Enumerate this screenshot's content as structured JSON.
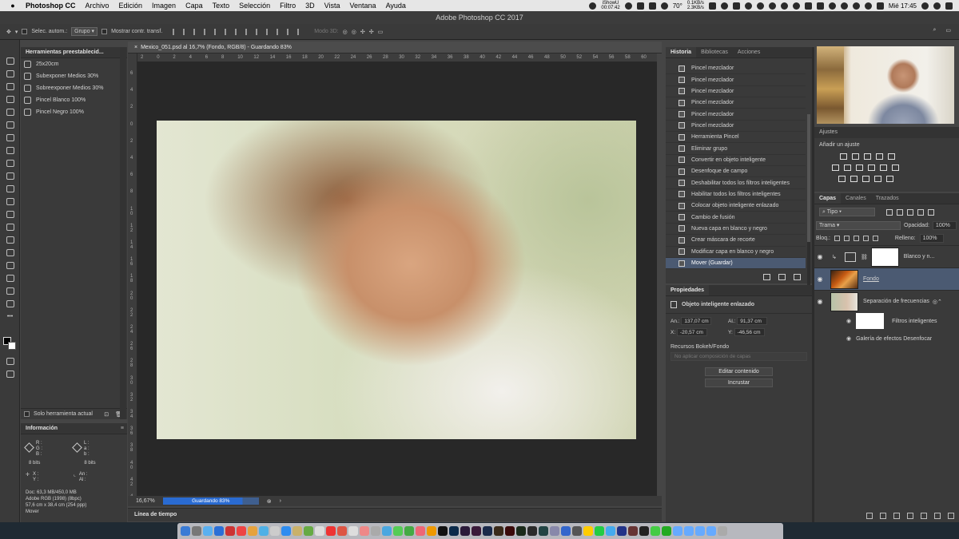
{
  "menubar": {
    "app": "Photoshop CC",
    "menus": [
      "Archivo",
      "Edición",
      "Imagen",
      "Capa",
      "Texto",
      "Selección",
      "Filtro",
      "3D",
      "Vista",
      "Ventana",
      "Ayuda"
    ],
    "ishowu": "iShowU",
    "ishowu_time": "00:07:42",
    "temperature": "70°",
    "net_up": "0.1KB/s",
    "net_down": "2.3KB/s",
    "clock": "Mié 17:45"
  },
  "window": {
    "title": "Adobe Photoshop CC 2017"
  },
  "options": {
    "auto_select_label": "Selec. autom.:",
    "auto_select_value": "Grupo",
    "show_transform_label": "Mostrar contr. transf.",
    "mode3d_label": "Modo 3D:"
  },
  "presets_panel": {
    "title": "Herramientas preestablecid...",
    "items": [
      {
        "label": "25x20cm",
        "icon": "crop-icon"
      },
      {
        "label": "Subexponer Medios 30%",
        "icon": "dodge-icon"
      },
      {
        "label": "Sobreexponer Medios 30%",
        "icon": "burn-icon"
      },
      {
        "label": "Pincel Blanco 100%",
        "icon": "brush-icon"
      },
      {
        "label": "Pincel Negro 100%",
        "icon": "brush-icon"
      }
    ],
    "current_tool_only": "Solo herramienta actual"
  },
  "info_panel": {
    "title": "Información",
    "rgb": [
      "R :",
      "G :",
      "B :"
    ],
    "lab": [
      "L :",
      "a :",
      "b :"
    ],
    "bits_left": "8 bits",
    "bits_right": "8 bits",
    "xy": [
      "X :",
      "Y :"
    ],
    "size": [
      "An :",
      "Al :"
    ],
    "doc": "Doc: 63,3 MB/450,0 MB",
    "profile": "Adobe RGB (1998) (8bpc)",
    "dimensions": "57,6 cm x 38,4 cm (254 ppp)",
    "tool": "Mover"
  },
  "document": {
    "tab": "Mexico_051.psd al 16,7% (Fondo, RGB/8) - Guardando 83%",
    "zoom": "16,67%",
    "status": "Guardando 83%",
    "progress": 0.83,
    "hruler": [
      "2",
      "0",
      "2",
      "4",
      "6",
      "8",
      "10",
      "12",
      "14",
      "16",
      "18",
      "20",
      "22",
      "24",
      "26",
      "28",
      "30",
      "32",
      "34",
      "36",
      "38",
      "40",
      "42",
      "44",
      "46",
      "48",
      "50",
      "52",
      "54",
      "56",
      "58",
      "60"
    ],
    "vruler": [
      "6",
      "4",
      "2",
      "0",
      "2",
      "4",
      "6",
      "8",
      "1 0",
      "1 2",
      "1 4",
      "1 6",
      "1 8",
      "2 0",
      "2 2",
      "2 4",
      "2 6",
      "2 8",
      "3 0",
      "3 2",
      "3 4",
      "3 6",
      "3 8",
      "4 0",
      "4 2",
      "4 4"
    ],
    "timeline": "Línea de tiempo"
  },
  "history_panel": {
    "tabs": [
      "Historia",
      "Bibliotecas",
      "Acciones"
    ],
    "items": [
      "Pincel mezclador",
      "Pincel mezclador",
      "Pincel mezclador",
      "Pincel mezclador",
      "Pincel mezclador",
      "Pincel mezclador",
      "Herramienta Pincel",
      "Eliminar grupo",
      "Convertir en objeto inteligente",
      "Desenfoque de campo",
      "Deshabilitar todos los filtros inteligentes",
      "Habilitar todos los filtros inteligentes",
      "Colocar objeto inteligente enlazado",
      "Cambio de fusión",
      "Nueva capa en blanco y negro",
      "Crear máscara de recorte",
      "Modificar capa en blanco y negro",
      "Mover (Guardar)"
    ],
    "selected_index": 17
  },
  "properties_panel": {
    "title": "Propiedades",
    "subtitle": "Objeto inteligente enlazado",
    "an_label": "An.:",
    "an_value": "137,07 cm",
    "al_label": "Al.:",
    "al_value": "91,37 cm",
    "x_label": "X:",
    "x_value": "-20,57 cm",
    "y_label": "Y:",
    "y_value": "-46,56 cm",
    "resources_label": "Recursos Bokeh/Fondo",
    "comp_placeholder": "No aplicar composición de capas",
    "edit_button": "Editar contenido",
    "embed_button": "Incrustar"
  },
  "adjustments_panel": {
    "title": "Ajustes",
    "add_label": "Añadir un ajuste"
  },
  "layers_panel": {
    "tabs": [
      "Capas",
      "Canales",
      "Trazados"
    ],
    "filter": "Tipo",
    "blend_mode": "Trama",
    "opacity_label": "Opacidad:",
    "opacity_value": "100%",
    "lock_label": "Bloq.:",
    "fill_label": "Relleno:",
    "fill_value": "100%",
    "layers": [
      {
        "name": "Blanco y n...",
        "kind": "adjustment"
      },
      {
        "name": "Fondo",
        "kind": "smart",
        "selected": true
      },
      {
        "name": "Separación de frecuencias",
        "kind": "smart"
      }
    ],
    "smart_filters": "Filtros inteligentes",
    "filter_name": "Galería de efectos Desenfocar"
  },
  "colors": {
    "selection": "#4b5a72",
    "progress": "#2a6bd1"
  }
}
